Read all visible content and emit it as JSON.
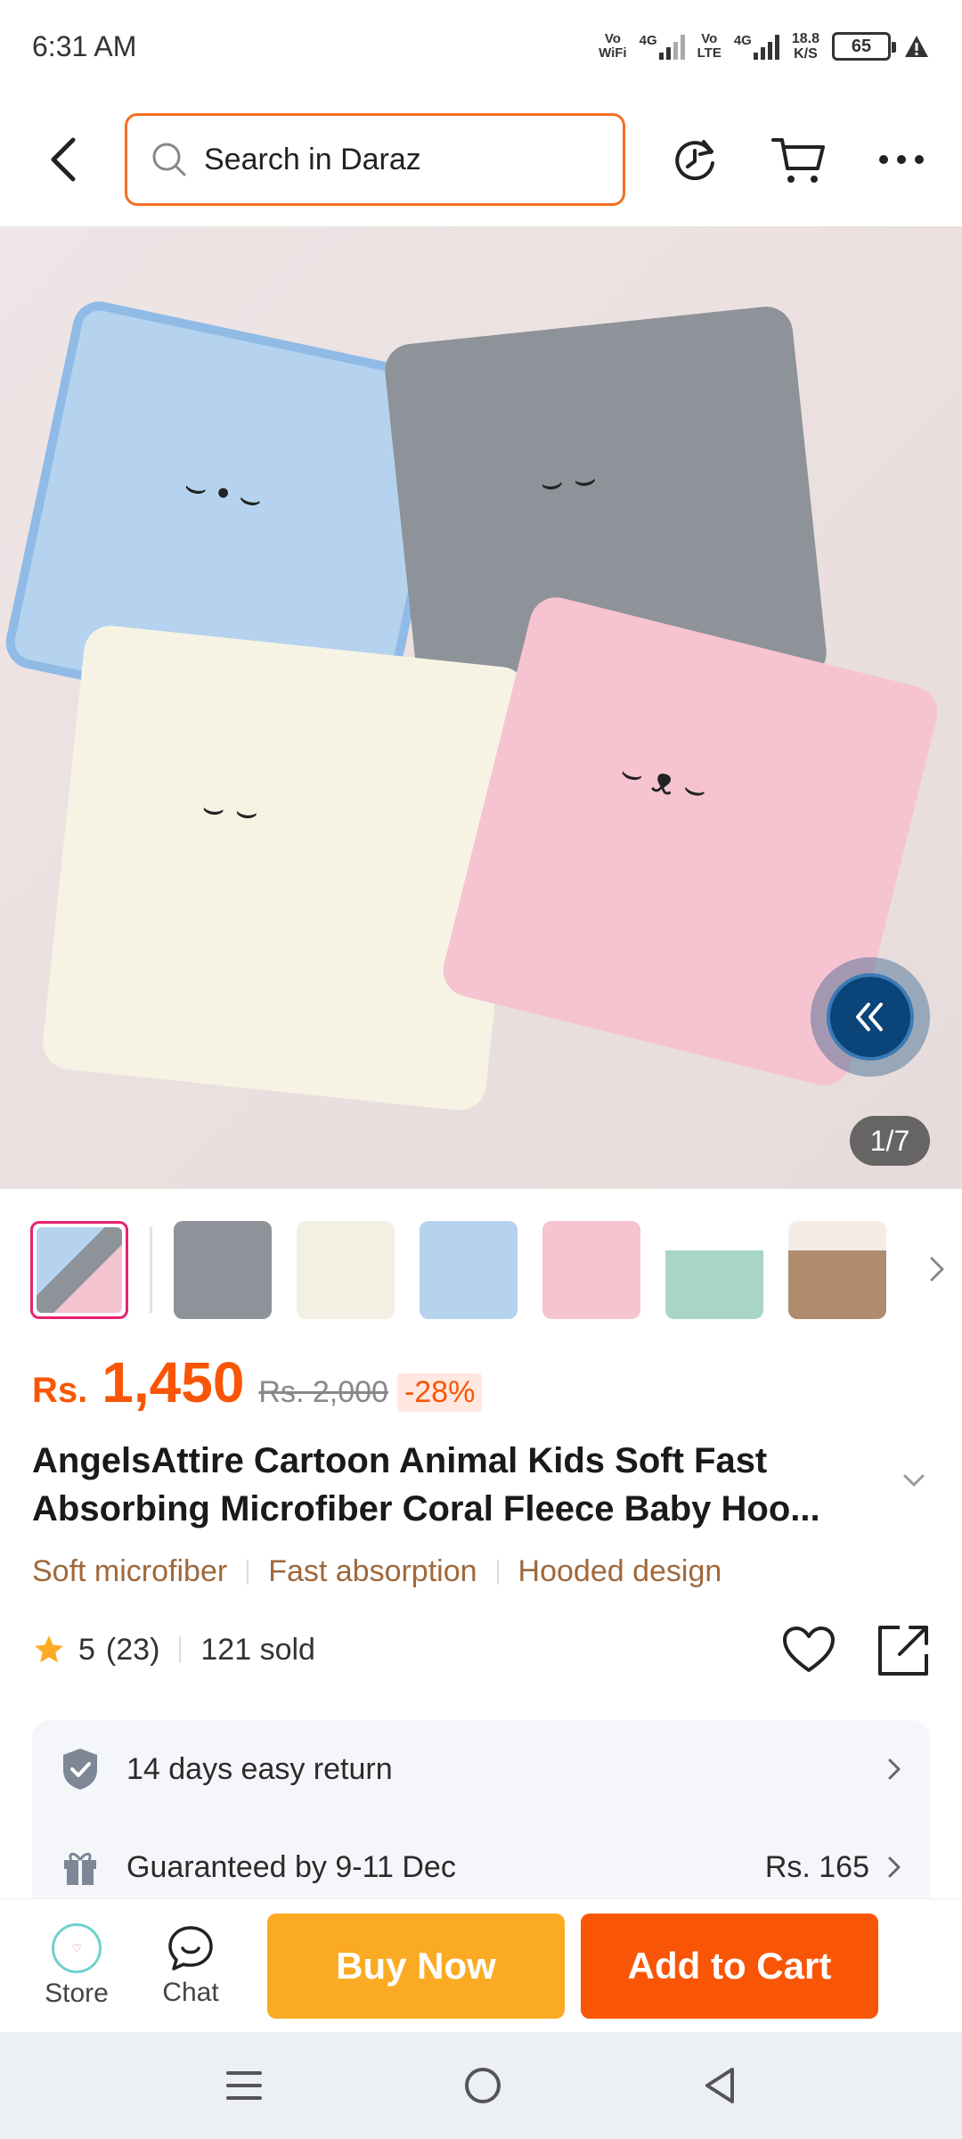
{
  "status_bar": {
    "time": "6:31 AM",
    "net1_top": "Vo",
    "net1_bottom": "WiFi",
    "net1_gen": "4G",
    "net2_top": "Vo",
    "net2_bottom": "LTE",
    "net2_gen": "4G",
    "speed_value": "18.8",
    "speed_unit": "K/S",
    "battery": "65"
  },
  "search": {
    "placeholder": "Search in Daraz"
  },
  "gallery": {
    "page_indicator": "1/7",
    "thumbnail_count": 7
  },
  "price": {
    "currency": "Rs.",
    "current": "1,450",
    "original": "Rs. 2,000",
    "discount": "-28%"
  },
  "product": {
    "title": "AngelsAttire Cartoon Animal Kids Soft Fast Absorbing Microfiber Coral Fleece Baby Hoo...",
    "tags": [
      "Soft microfiber",
      "Fast absorption",
      "Hooded design"
    ],
    "rating": "5",
    "review_count": "(23)",
    "sold": "121 sold"
  },
  "services": {
    "return": "14 days easy return",
    "delivery": "Guaranteed by 9-11 Dec",
    "delivery_fee": "Rs. 165"
  },
  "actions": {
    "store_label": "Store",
    "chat_label": "Chat",
    "buy_now": "Buy Now",
    "add_to_cart": "Add to Cart"
  },
  "colors": {
    "brand_orange": "#f85606",
    "buy_yellow": "#fbab23",
    "tag_brown": "#a0683a",
    "active_thumb_border": "#e6236e"
  },
  "icons": [
    "back-icon",
    "search-icon",
    "history-icon",
    "cart-icon",
    "more-icon",
    "collapse-icon",
    "chevron-right-icon",
    "chevron-down-icon",
    "star-icon",
    "heart-icon",
    "share-icon",
    "shield-check-icon",
    "gift-icon",
    "chat-icon",
    "menu-icon",
    "home-circle-icon",
    "back-triangle-icon"
  ]
}
